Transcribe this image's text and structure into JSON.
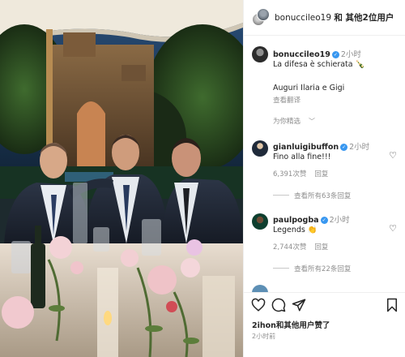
{
  "header": {
    "username": "bonuccileo19",
    "others_text": "和 其他2位用户"
  },
  "caption": {
    "username": "bonuccileo19",
    "time": "2小时",
    "line1": "La difesa è schierata 🍾",
    "line2": "Auguri Ilaria e Gigi",
    "translate": "查看翻译",
    "featured": "为你精选"
  },
  "comments": [
    {
      "username": "gianluigibuffon",
      "time": "2小时",
      "text": "Fino alla fine!!!",
      "likes": "6,391次赞",
      "reply": "回复",
      "view_replies": "查看所有63条回复"
    },
    {
      "username": "paulpogba",
      "time": "2小时",
      "text": "Legends 👏",
      "likes": "2,744次赞",
      "reply": "回复",
      "view_replies": "查看所有22条回复"
    }
  ],
  "footer": {
    "likes_user": "2ihon",
    "likes_rest": "和其他用户赞了",
    "time": "2小时前"
  },
  "icons": [
    "like-icon",
    "comment-icon",
    "share-icon",
    "save-icon",
    "verified-icon",
    "heart-icon"
  ],
  "colors": {
    "verified": "#3897f0",
    "muted": "#8e8e8e",
    "text": "#262626"
  }
}
